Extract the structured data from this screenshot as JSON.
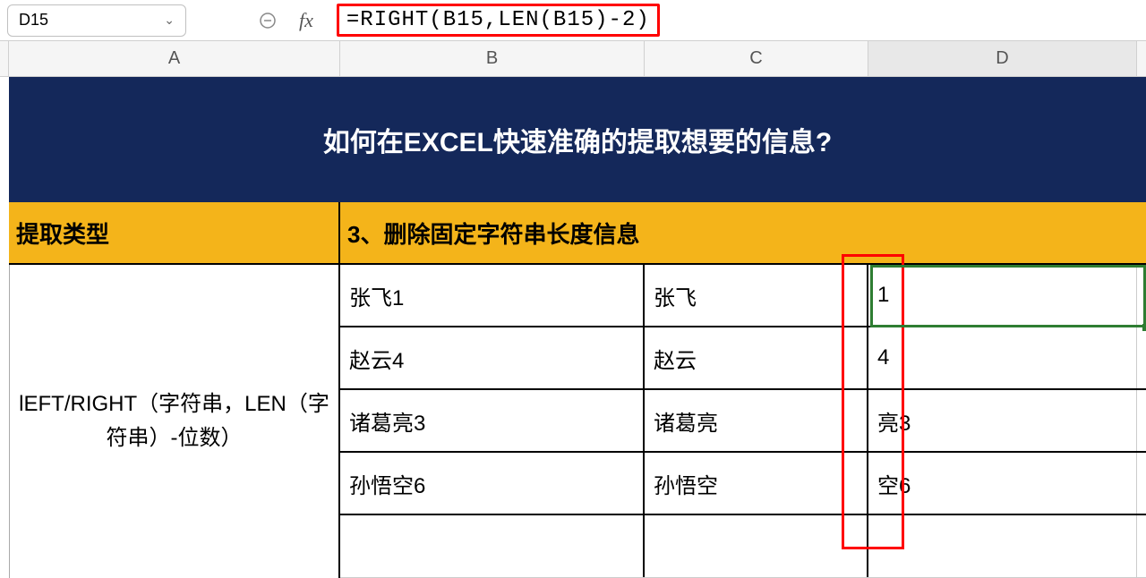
{
  "namebox": {
    "value": "D15"
  },
  "fx_label": "fx",
  "formula": "=RIGHT(B15,LEN(B15)-2)",
  "columns": {
    "A": "A",
    "B": "B",
    "C": "C",
    "D": "D"
  },
  "title_row": "如何在EXCEL快速准确的提取想要的信息?",
  "headers": {
    "type_label": "提取类型",
    "section_title": "3、删除固定字符串长度信息"
  },
  "merged_description": "lEFT/RIGHT（字符串，LEN（字符串）-位数）",
  "rows": [
    {
      "b": "张飞1",
      "c": "张飞",
      "d": "1"
    },
    {
      "b": "赵云4",
      "c": "赵云",
      "d": "4"
    },
    {
      "b": "诸葛亮3",
      "c": "诸葛亮",
      "d": "亮3"
    },
    {
      "b": "孙悟空6",
      "c": "孙悟空",
      "d": "空6"
    }
  ],
  "colors": {
    "title_bg": "#14285a",
    "header_bg": "#f4b41a",
    "highlight_red": "#ff0000",
    "highlight_green": "#2e7d32"
  }
}
